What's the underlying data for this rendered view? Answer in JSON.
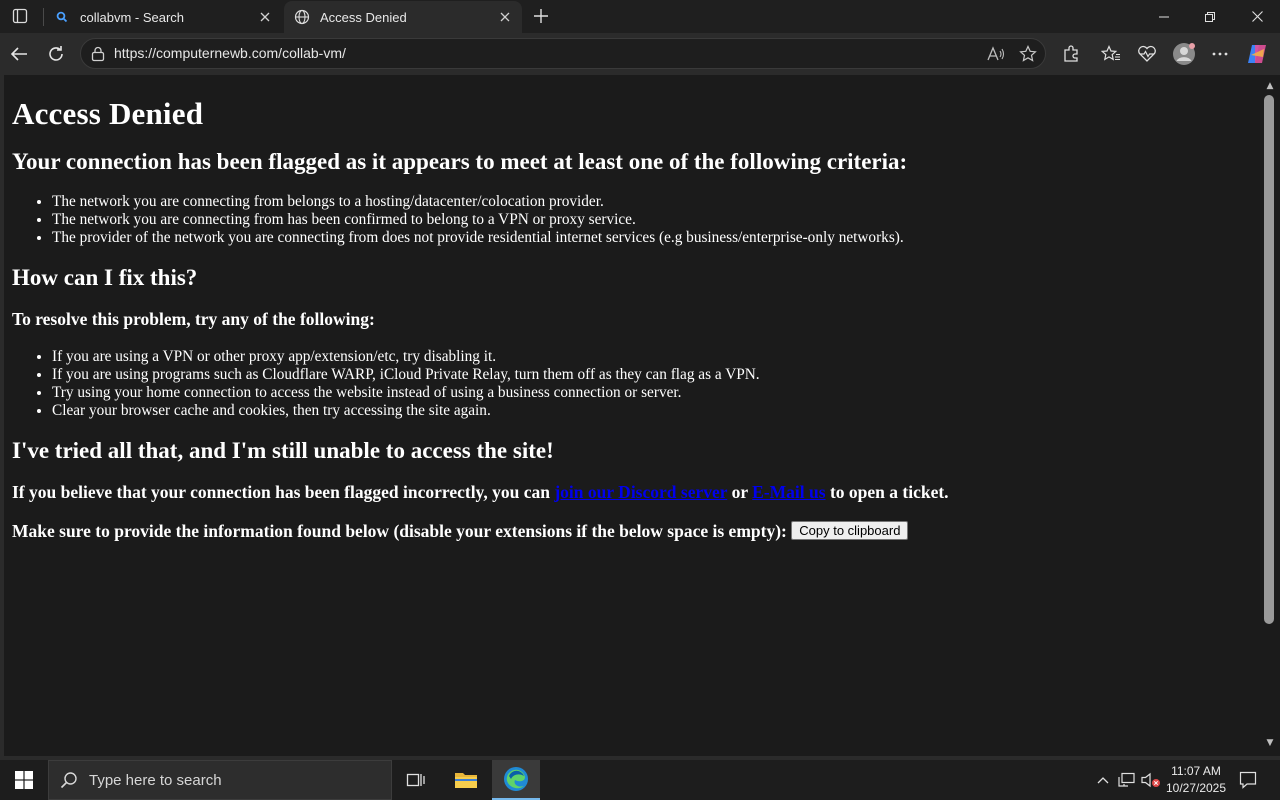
{
  "browser": {
    "tabs": [
      {
        "title": "collabvm - Search",
        "icon": "search-icon",
        "active": false
      },
      {
        "title": "Access Denied",
        "icon": "globe-icon",
        "active": true
      }
    ],
    "url": "https://computernewb.com/collab-vm/"
  },
  "page": {
    "title": "Access Denied",
    "criteria_heading": "Your connection has been flagged as it appears to meet at least one of the following criteria:",
    "criteria": [
      "The network you are connecting from belongs to a hosting/datacenter/colocation provider.",
      "The network you are connecting from has been confirmed to belong to a VPN or proxy service.",
      "The provider of the network you are connecting from does not provide residential internet services (e.g business/enterprise-only networks)."
    ],
    "fix_heading": "How can I fix this?",
    "resolve_heading": "To resolve this problem, try any of the following:",
    "fixes": [
      "If you are using a VPN or other proxy app/extension/etc, try disabling it.",
      "If you are using programs such as Cloudflare WARP, iCloud Private Relay, turn them off as they can flag as a VPN.",
      "Try using your home connection to access the website instead of using a business connection or server.",
      "Clear your browser cache and cookies, then try accessing the site again."
    ],
    "tried_heading": "I've tried all that, and I'm still unable to access the site!",
    "contact_prefix": "If you believe that your connection has been flagged incorrectly, you can ",
    "discord_link": "join our Discord server",
    "contact_or": " or ",
    "email_link": "E-Mail us",
    "contact_suffix": " to open a ticket.",
    "info_text": "Make sure to provide the information found below (disable your extensions if the below space is empty): ",
    "copy_button": "Copy to clipboard"
  },
  "taskbar": {
    "search_placeholder": "Type here to search",
    "time": "11:07 AM",
    "date": "10/27/2025"
  },
  "colors": {
    "page_bg": "#1b1b1b",
    "link": "#0000ee",
    "chrome_bg": "#2b2b2b"
  }
}
